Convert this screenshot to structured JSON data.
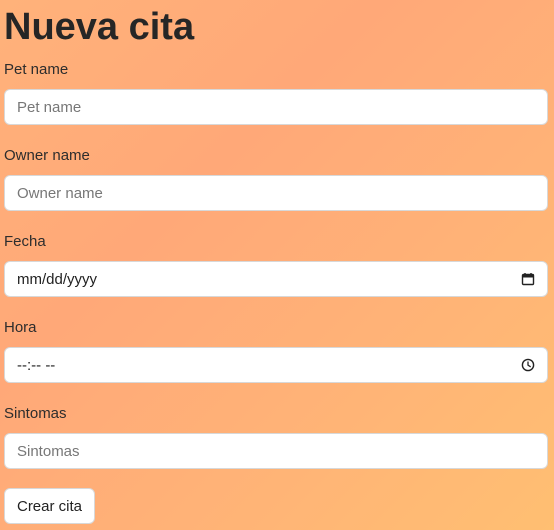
{
  "page": {
    "title": "Nueva cita"
  },
  "form": {
    "pet_name": {
      "label": "Pet name",
      "placeholder": "Pet name",
      "value": ""
    },
    "owner_name": {
      "label": "Owner name",
      "placeholder": "Owner name",
      "value": ""
    },
    "fecha": {
      "label": "Fecha",
      "display_value": "mm/dd/yyyy",
      "icon": "calendar-icon"
    },
    "hora": {
      "label": "Hora",
      "display_value": "--:-- --",
      "icon": "clock-icon"
    },
    "sintomas": {
      "label": "Sintomas",
      "placeholder": "Sintomas",
      "value": ""
    },
    "submit_label": "Crear cita"
  },
  "colors": {
    "background_start": "#ffb27a",
    "background_end": "#ffbf72",
    "field_background": "#ffffff",
    "field_border": "#d8d8d8",
    "text": "#262626",
    "placeholder": "#777777"
  }
}
